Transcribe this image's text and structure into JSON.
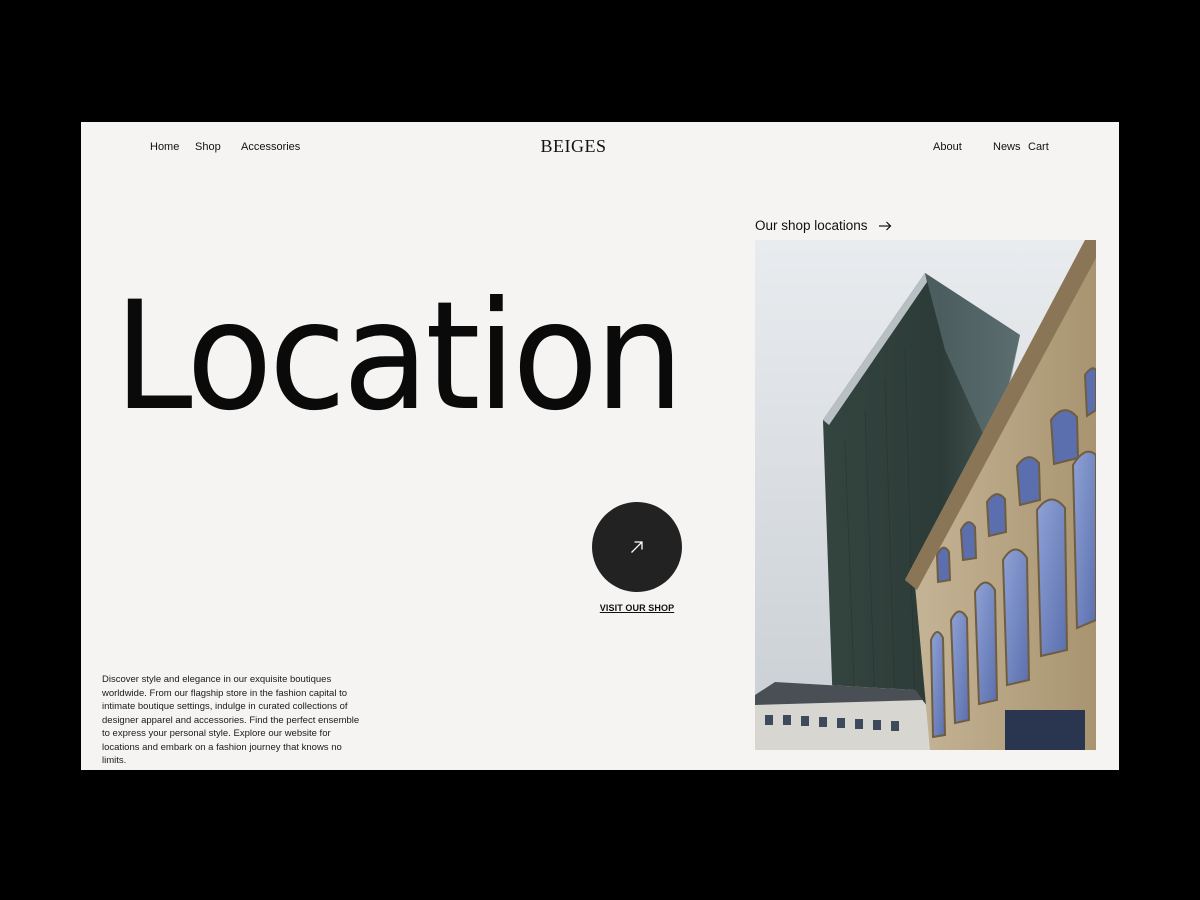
{
  "nav": {
    "left": [
      "Home",
      "Shop",
      "Accessories"
    ],
    "right": [
      "About",
      "News",
      "Cart"
    ]
  },
  "brand": "BEIGES",
  "hero": {
    "title": "Location"
  },
  "cta": {
    "label": "VISIT OUR SHOP",
    "icon": "arrow-up-right-icon"
  },
  "description": "Discover style and elegance in our exquisite boutiques worldwide. From our flagship store in the fashion capital to intimate boutique settings, indulge in curated collections of designer apparel and accessories. Find the perfect ensemble to express your personal style. Explore our website for locations and embark on a fashion journey that knows no limits.",
  "locations": {
    "label": "Our shop locations",
    "icon": "arrow-right-icon"
  },
  "colors": {
    "page_background": "#000000",
    "panel_background": "#f5f4f2",
    "text": "#111111",
    "button": "#222222"
  }
}
